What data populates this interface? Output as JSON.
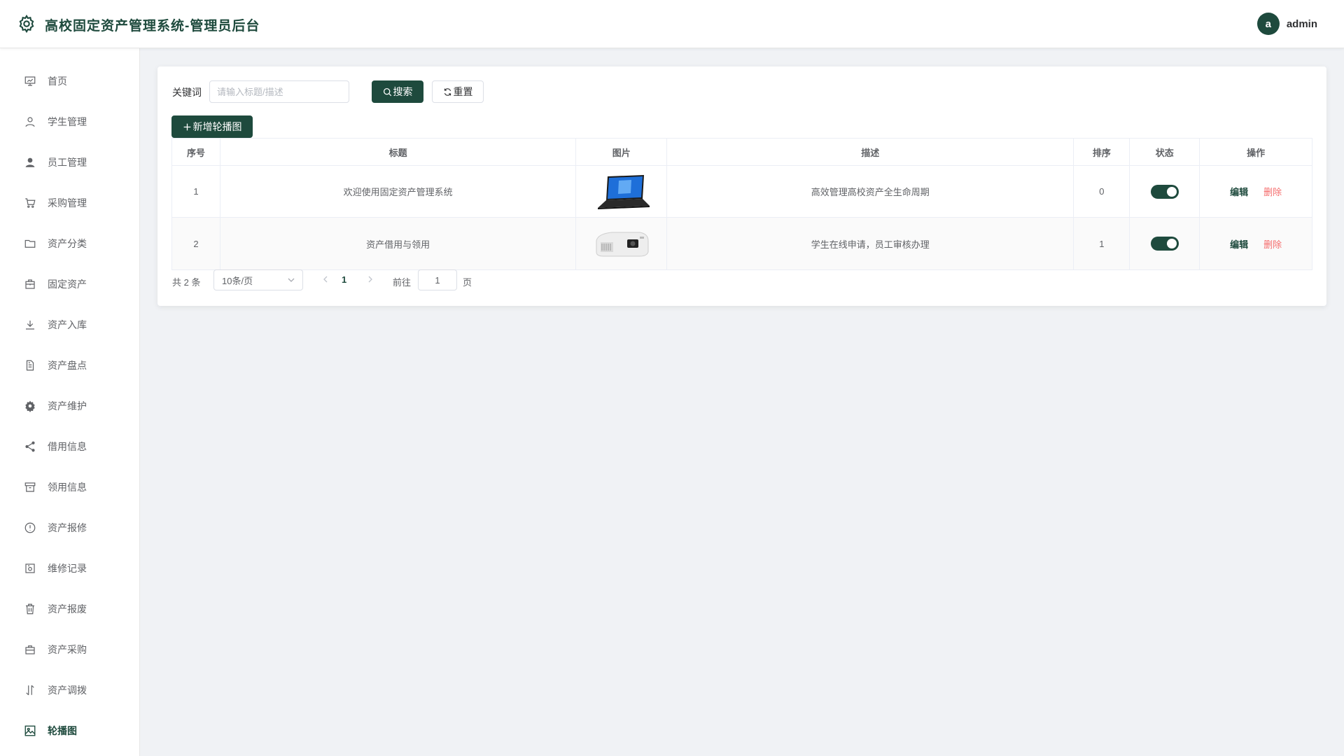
{
  "header": {
    "title": "高校固定资产管理系统-管理员后台",
    "user_avatar_letter": "a",
    "username": "admin",
    "logo_icon": "gear-icon"
  },
  "sidebar": {
    "items": [
      {
        "label": "首页",
        "icon": "dashboard-icon",
        "active": false
      },
      {
        "label": "学生管理",
        "icon": "user-outline-icon",
        "active": false
      },
      {
        "label": "员工管理",
        "icon": "user-filled-icon",
        "active": false
      },
      {
        "label": "采购管理",
        "icon": "cart-icon",
        "active": false
      },
      {
        "label": "资产分类",
        "icon": "folder-icon",
        "active": false
      },
      {
        "label": "固定资产",
        "icon": "briefcase-icon",
        "active": false
      },
      {
        "label": "资产入库",
        "icon": "download-icon",
        "active": false
      },
      {
        "label": "资产盘点",
        "icon": "document-icon",
        "active": false
      },
      {
        "label": "资产维护",
        "icon": "settings-icon",
        "active": false
      },
      {
        "label": "借用信息",
        "icon": "share-icon",
        "active": false
      },
      {
        "label": "领用信息",
        "icon": "box-icon",
        "active": false
      },
      {
        "label": "资产报修",
        "icon": "warning-icon",
        "active": false
      },
      {
        "label": "维修记录",
        "icon": "camera-icon",
        "active": false
      },
      {
        "label": "资产报废",
        "icon": "trash-icon",
        "active": false
      },
      {
        "label": "资产采购",
        "icon": "bag-icon",
        "active": false
      },
      {
        "label": "资产调拨",
        "icon": "transfer-icon",
        "active": false
      },
      {
        "label": "轮播图",
        "icon": "picture-icon",
        "active": true
      }
    ]
  },
  "search": {
    "label": "关键词",
    "placeholder": "请输入标题/描述",
    "value": "",
    "search_label": "搜索",
    "reset_label": "重置"
  },
  "toolbar": {
    "add_label": "新增轮播图"
  },
  "table": {
    "columns": [
      "序号",
      "标题",
      "图片",
      "描述",
      "排序",
      "状态",
      "操作"
    ],
    "rows": [
      {
        "index": "1",
        "title": "欢迎使用固定资产管理系统",
        "image": "laptop-image",
        "desc": "高效管理高校资产全生命周期",
        "sort": "0",
        "status": true,
        "edit": "编辑",
        "delete": "删除"
      },
      {
        "index": "2",
        "title": "资产借用与领用",
        "image": "projector-image",
        "desc": "学生在线申请，员工审核办理",
        "sort": "1",
        "status": true,
        "edit": "编辑",
        "delete": "删除"
      }
    ]
  },
  "pagination": {
    "total_text": "共 2 条",
    "page_size": "10条/页",
    "current_page": "1",
    "goto_label": "前往",
    "goto_value": "1",
    "page_suffix": "页"
  },
  "colors": {
    "primary": "#1e4a3d",
    "danger": "#f56c6c",
    "background": "#f0f2f5"
  }
}
